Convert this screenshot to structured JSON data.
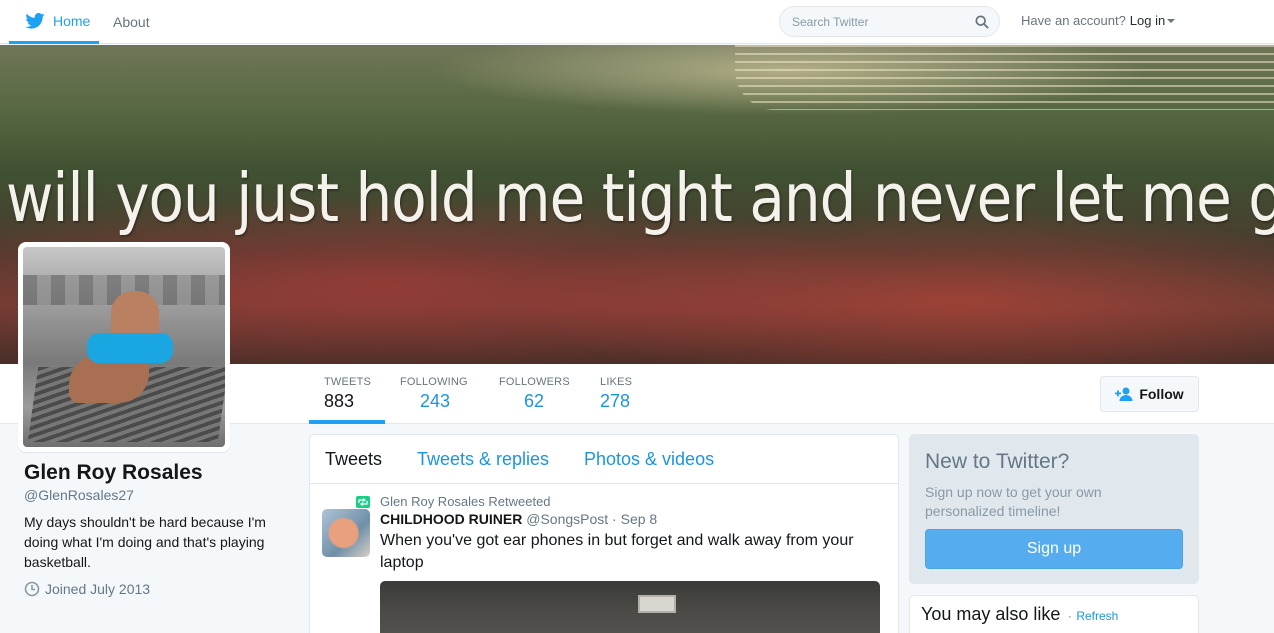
{
  "nav": {
    "home_label": "Home",
    "about_label": "About",
    "search_placeholder": "Search Twitter",
    "account_prompt": "Have an account?",
    "login_label": "Log in",
    "accent_color": "#1da1f2"
  },
  "banner": {
    "quote": "will you just hold me tight and never let me go?"
  },
  "profile_nav": {
    "stats": [
      {
        "label": "TWEETS",
        "value": "883"
      },
      {
        "label": "FOLLOWING",
        "value": "243"
      },
      {
        "label": "FOLLOWERS",
        "value": "62"
      },
      {
        "label": "LIKES",
        "value": "278"
      }
    ],
    "follow_label": "Follow"
  },
  "profile": {
    "name": "Glen Roy Rosales",
    "handle": "@GlenRosales27",
    "bio": "My days shouldn't be hard because I'm doing what I'm doing and that's playing basketball.",
    "joined": "Joined July 2013"
  },
  "timeline": {
    "tabs": [
      "Tweets",
      "Tweets & replies",
      "Photos & videos"
    ],
    "tweet": {
      "retweet_note": "Glen Roy Rosales Retweeted",
      "author_name": "CHILDHOOD RUINER",
      "author_handle": "@SongsPost",
      "separator": "·",
      "date": "Sep 8",
      "text": "When you've got ear phones in but forget and walk away from your laptop"
    }
  },
  "sidebar": {
    "signup_title": "New to Twitter?",
    "signup_text": "Sign up now to get your own personalized timeline!",
    "signup_button": "Sign up",
    "suggest_title": "You may also like",
    "suggest_dot": "·",
    "refresh_label": "Refresh"
  },
  "icons": {
    "bird": "twitter-bird-icon",
    "search": "search-icon",
    "caret": "caret-down-icon",
    "follow": "add-user-icon",
    "clock": "clock-icon",
    "retweet": "retweet-icon"
  }
}
